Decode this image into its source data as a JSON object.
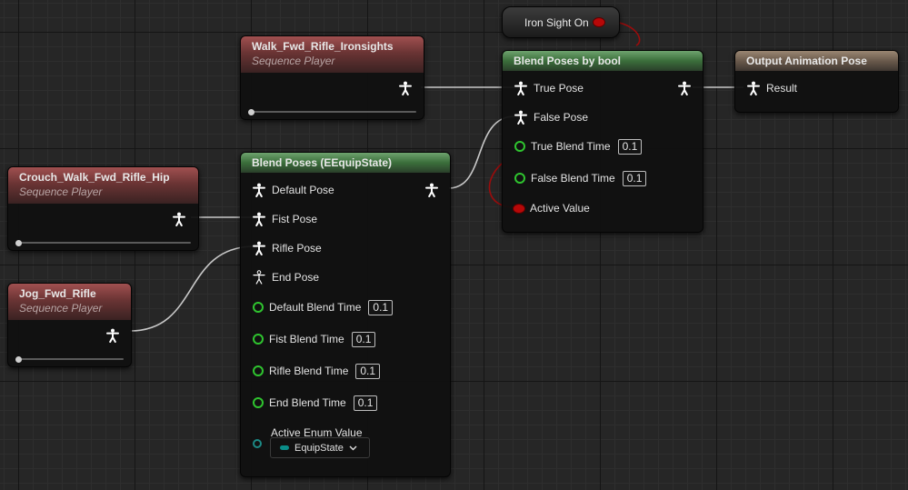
{
  "graph": {
    "nodes": {
      "walk_fwd": {
        "title": "Walk_Fwd_Rifle_Ironsights",
        "subtitle": "Sequence Player",
        "progress": 0.0
      },
      "crouch_walk": {
        "title": "Crouch_Walk_Fwd_Rifle_Hip",
        "subtitle": "Sequence Player",
        "progress": 0.0
      },
      "jog_fwd": {
        "title": "Jog_Fwd_Rifle",
        "subtitle": "Sequence Player",
        "progress": 0.0
      },
      "iron_sight": {
        "title": "Iron Sight On"
      },
      "blend_bool": {
        "title": "Blend Poses by bool",
        "pins": {
          "true_pose": "True Pose",
          "false_pose": "False Pose",
          "true_blend_time": "True Blend Time",
          "true_blend_time_value": "0.1",
          "false_blend_time": "False Blend Time",
          "false_blend_time_value": "0.1",
          "active_value": "Active Value"
        }
      },
      "output_pose": {
        "title": "Output Animation Pose",
        "result": "Result"
      },
      "blend_enum": {
        "title": "Blend Poses (EEquipState)",
        "pins": {
          "default_pose": "Default Pose",
          "fist_pose": "Fist Pose",
          "rifle_pose": "Rifle Pose",
          "end_pose": "End Pose",
          "default_blend_time": "Default Blend Time",
          "default_blend_time_value": "0.1",
          "fist_blend_time": "Fist Blend Time",
          "fist_blend_time_value": "0.1",
          "rifle_blend_time": "Rifle Blend Time",
          "rifle_blend_time_value": "0.1",
          "end_blend_time": "End Blend Time",
          "end_blend_time_value": "0.1",
          "active_enum_value": "Active Enum Value",
          "enum_selected": "EquipState"
        }
      }
    },
    "colors": {
      "pose_wire": "#c8c8c8",
      "bool_wire": "#9a0c0c",
      "float_pin": "#2fc42f",
      "bool_pin": "#b60808",
      "enum_pin": "#1c8a85"
    },
    "icons": {
      "pose": "pose-person-icon",
      "float": "float-pin-icon",
      "bool": "bool-pin-icon",
      "enum": "enum-pin-icon",
      "dropdown": "chevron-down-icon"
    }
  }
}
